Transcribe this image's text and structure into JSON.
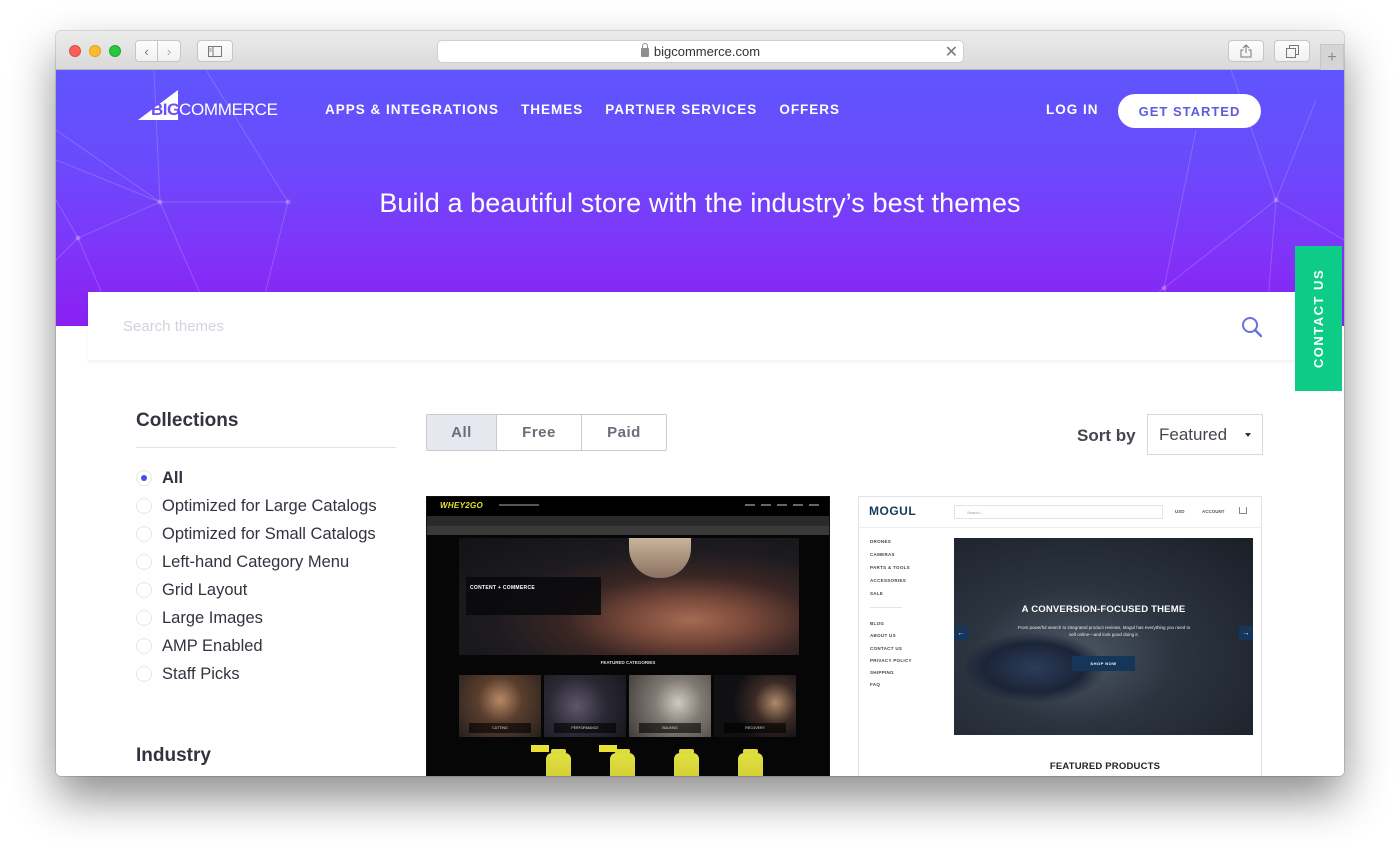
{
  "browser": {
    "url": "bigcommerce.com",
    "back_icon": "chevron-left-icon",
    "forward_icon": "chevron-right-icon",
    "sidebar_icon": "sidebar-icon",
    "share_icon": "share-icon",
    "tabs_icon": "tabs-icon",
    "new_tab_label": "+"
  },
  "header": {
    "logo_big": "BIG",
    "logo_commerce": "COMMERCE",
    "nav": [
      {
        "label": "APPS & INTEGRATIONS"
      },
      {
        "label": "THEMES"
      },
      {
        "label": "PARTNER SERVICES"
      },
      {
        "label": "OFFERS"
      }
    ],
    "login_label": "LOG IN",
    "get_started_label": "GET STARTED"
  },
  "hero": {
    "title": "Build a beautiful store with the industry’s best themes"
  },
  "search": {
    "placeholder": "Search themes",
    "value": ""
  },
  "contact_us_label": "CONTACT US",
  "sidebar": {
    "collections_heading": "Collections",
    "collections": [
      {
        "label": "All",
        "checked": true
      },
      {
        "label": "Optimized for Large Catalogs",
        "checked": false
      },
      {
        "label": "Optimized for Small Catalogs",
        "checked": false
      },
      {
        "label": "Left-hand Category Menu",
        "checked": false
      },
      {
        "label": "Grid Layout",
        "checked": false
      },
      {
        "label": "Large Images",
        "checked": false
      },
      {
        "label": "AMP Enabled",
        "checked": false
      },
      {
        "label": "Staff Picks",
        "checked": false
      }
    ],
    "industry_heading": "Industry"
  },
  "filters": {
    "price_tabs": [
      {
        "label": "All",
        "active": true
      },
      {
        "label": "Free",
        "active": false
      },
      {
        "label": "Paid",
        "active": false
      }
    ],
    "sort_label": "Sort by",
    "sort_value": "Featured"
  },
  "themes": [
    {
      "name": "WHEY2GO",
      "preview": {
        "hero_title": "CONTENT + COMMERCE",
        "section_title": "FEATURED CATEGORIES",
        "categories": [
          "CUTTING",
          "PERFORMANCE",
          "BULKING",
          "RECOVERY"
        ]
      }
    },
    {
      "name": "MOGUL",
      "preview": {
        "search_placeholder": "Search...",
        "currency": "USD",
        "account": "ACCOUNT",
        "menu": [
          "DRONES",
          "CAMERAS",
          "PARTS & TOOLS",
          "ACCESSORIES",
          "SALE"
        ],
        "menu_secondary": [
          "BLOG",
          "ABOUT US",
          "CONTACT US",
          "PRIVACY POLICY",
          "SHIPPING",
          "FAQ"
        ],
        "hero_title": "A CONVERSION-FOCUSED THEME",
        "hero_subtitle": "From powerful search to integrated product reviews, Mogul has everything you need to sell online—and look good doing it.",
        "cta": "SHOP NOW",
        "section_title": "FEATURED PRODUCTS"
      }
    }
  ],
  "colors": {
    "brand_purple": "#5e55fd",
    "hero_bottom": "#8a1ff3",
    "contact_green": "#0dcc87",
    "radio_accent": "#4a4ee8"
  }
}
